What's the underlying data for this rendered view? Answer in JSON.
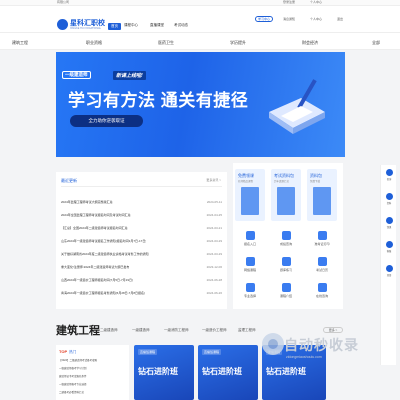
{
  "topbar": {
    "left": "有限公司",
    "right1": "登录注册",
    "right2": "个人中心"
  },
  "header": {
    "logo_name": "星科汇职校",
    "logo_sub": "XINGKE HUI VOCATIONAL",
    "nav": [
      "首页",
      "课程中心",
      "直播课堂",
      "考试动态"
    ],
    "user_pill": "学习中心",
    "util1": "消息通知",
    "util2": "个人中心",
    "util3": "退出"
  },
  "categories": [
    "建筑工程",
    "职业资格",
    "医药卫生",
    "学历提升",
    "财会经济",
    "全部"
  ],
  "banner": {
    "tag1": "一级建造师",
    "tag2": "新课上线啦!",
    "headline": "学习有方法 通关有捷径",
    "cta": "全力助你逆袭取证"
  },
  "news": {
    "title": "最近更新",
    "more": "更多资讯 >",
    "rows": [
      {
        "t": "2024年监理工程师考试大纲完整版汇总",
        "d": "2024-05-11"
      },
      {
        "t": "2024年全国监理工程师考试报名时间及考试时间汇总",
        "d": "2024-04-25"
      },
      {
        "t": "【汇总】全国2024年二级建造师考试报名时间汇总",
        "d": "2024-03-21"
      },
      {
        "t": "山东2024年一级建造师考试报名工作通知(报名时间3月7日-17日)",
        "d": "2024-03-29"
      },
      {
        "t": "关于做好湖南省2024年度二级建造师执业资格考试考务工作的通知",
        "d": "2024-03-29"
      },
      {
        "t": "重大变化!注册师:2024年二级建造师考试大纲已发布",
        "d": "2023-12-06"
      },
      {
        "t": "山西2024年一级造价工程师报名时间(7月5日-7月19日)",
        "d": "2024-06-28"
      },
      {
        "t": "青海2024年一级造价工程师报名考务通知(6月28日-7月8日报名)",
        "d": "2024-06-26"
      }
    ]
  },
  "services": {
    "cards": [
      {
        "h": "免费领课",
        "s": "名师精品课程"
      },
      {
        "h": "考试资料包",
        "s": "历年真题汇总"
      },
      {
        "h": "资料包",
        "s": "免费下载"
      }
    ],
    "items": [
      "报名入口",
      "成绩查询",
      "准考证打印",
      "网络课程",
      "题库练习",
      "考试日历",
      "专业选择",
      "课程介绍",
      "在线咨询"
    ]
  },
  "sidetools": [
    "咨询",
    "资料",
    "领课",
    "客服",
    "顶部"
  ],
  "section": {
    "title": "建筑工程",
    "tabs": [
      "二级建造师",
      "一级建造师",
      "一级消防工程师",
      "一级造价工程师",
      "监理工程师"
    ],
    "more": "更多 >"
  },
  "hotlist": {
    "head": "TOP",
    "head_sub": "热门",
    "rows": [
      "【2024】二级建造师考试备考攻略",
      "一级建造师备考学习计划",
      "建造师证书考试报名条件",
      "一级建造师报考专业选择",
      "二建备考必看资料汇总"
    ]
  },
  "courses": [
    {
      "lab": "直播班课程",
      "nm": "钻石进阶班"
    },
    {
      "lab": "直播班课程",
      "nm": "钻石进阶班"
    },
    {
      "lab": "录播课程",
      "nm": "钻石进阶班"
    }
  ],
  "watermark": {
    "text": "自动秒收录",
    "sub": "zidongmiaoshoulu.com"
  },
  "colors": {
    "brand": "#1e5fd8",
    "hot": "#e0391f",
    "bg": "#f3f4f6"
  }
}
